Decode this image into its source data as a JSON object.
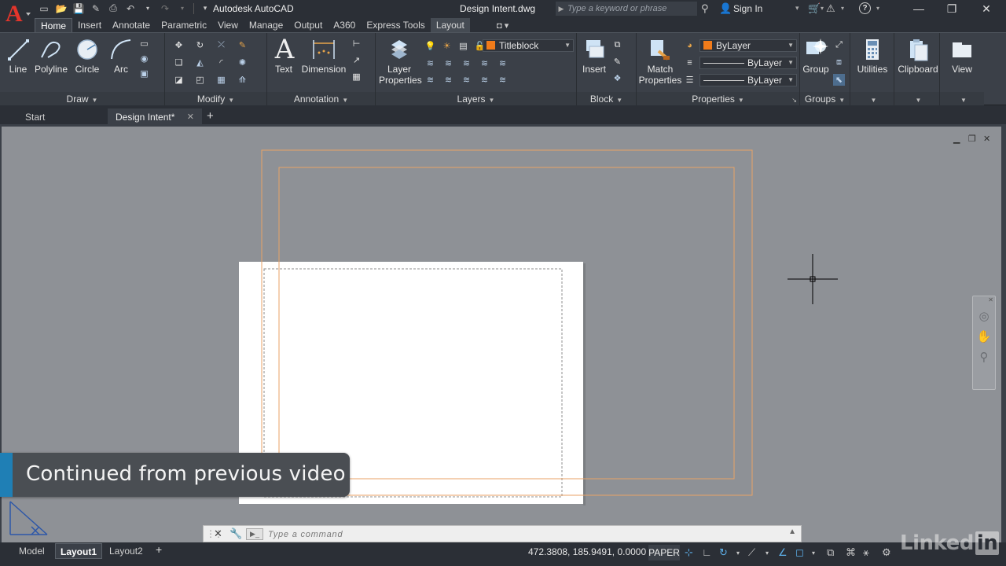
{
  "titlebar": {
    "app_title": "Autodesk AutoCAD",
    "doc_title": "Design Intent.dwg",
    "search_placeholder": "Type a keyword or phrase",
    "sign_in": "Sign In"
  },
  "ribbon_tabs": [
    "Home",
    "Insert",
    "Annotate",
    "Parametric",
    "View",
    "Manage",
    "Output",
    "A360",
    "Express Tools",
    "Layout"
  ],
  "active_ribbon_tab": "Home",
  "ribbon": {
    "draw": {
      "title": "Draw",
      "tools": [
        "Line",
        "Polyline",
        "Circle",
        "Arc"
      ]
    },
    "modify": {
      "title": "Modify"
    },
    "annotation": {
      "title": "Annotation",
      "tools": [
        "Text",
        "Dimension"
      ]
    },
    "layers": {
      "title": "Layers",
      "layer_properties": "Layer Properties",
      "current_layer": "Titleblock"
    },
    "block": {
      "title": "Block",
      "insert": "Insert"
    },
    "properties": {
      "title": "Properties",
      "match_properties": "Match Properties",
      "color": "ByLayer",
      "linetype": "ByLayer",
      "lineweight": "ByLayer"
    },
    "groups": {
      "title": "Groups",
      "group": "Group"
    },
    "utilities": "Utilities",
    "clipboard": "Clipboard",
    "view": "View"
  },
  "file_tabs": {
    "start": "Start",
    "active": "Design Intent*"
  },
  "banner": {
    "text": "Continued from previous video"
  },
  "command_line": {
    "placeholder": "Type a command"
  },
  "layout_tabs": [
    "Model",
    "Layout1",
    "Layout2"
  ],
  "active_layout_tab": "Layout1",
  "status": {
    "coordinates": "472.3808, 185.9491, 0.0000",
    "space": "PAPER"
  },
  "watermark": {
    "text": "Linked",
    "box": "in"
  },
  "colors": {
    "app_red": "#e4352b",
    "layer_orange": "#f07b1a",
    "canvas_grey": "#8e9196",
    "banner_blue": "#1f7fb5",
    "dark_ui": "#2b2f36",
    "ribbon_bg": "#3b4048"
  }
}
